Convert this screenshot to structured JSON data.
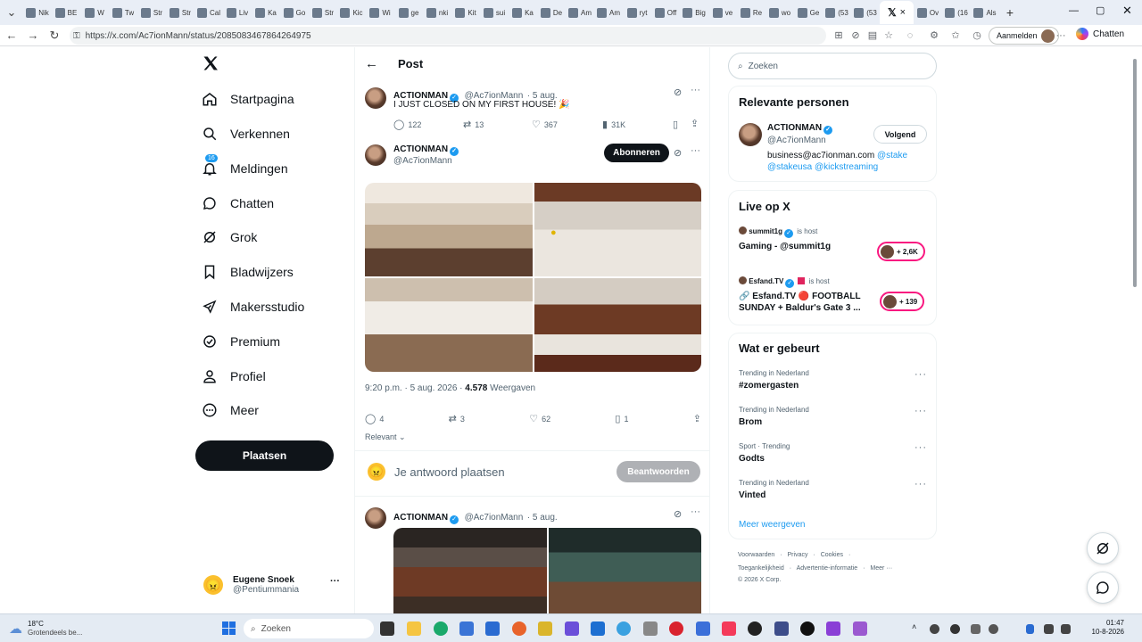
{
  "browser": {
    "tabs": [
      "Nik",
      "BE",
      "W",
      "Tw",
      "Str",
      "Str",
      "Cal",
      "Liv",
      "Ka",
      "Go",
      "Str",
      "Kic",
      "Wi",
      "ge",
      "nki",
      "Kit",
      "sui",
      "Ka",
      "De",
      "Am",
      "Am",
      "ryt",
      "Off",
      "Big",
      "ve",
      "Re",
      "wo",
      "Ge",
      "(53",
      "(53"
    ],
    "active_tab_close": "×",
    "extra_tabs": [
      "Ov",
      "(16",
      "Als"
    ],
    "new_tab": "+",
    "url": "https://x.com/Ac7ionMann/status/2085083467864264975",
    "signin_label": "Aanmelden",
    "copilot_label": "Chatten"
  },
  "nav": {
    "logo": "X",
    "items": [
      {
        "label": "Startpagina",
        "icon": "home-icon"
      },
      {
        "label": "Verkennen",
        "icon": "search-icon"
      },
      {
        "label": "Meldingen",
        "icon": "bell-icon",
        "badge": "16"
      },
      {
        "label": "Chatten",
        "icon": "chat-icon"
      },
      {
        "label": "Grok",
        "icon": "grok-icon"
      },
      {
        "label": "Bladwijzers",
        "icon": "bookmark-icon"
      },
      {
        "label": "Makersstudio",
        "icon": "rocket-icon"
      },
      {
        "label": "Premium",
        "icon": "premium-icon"
      },
      {
        "label": "Profiel",
        "icon": "profile-icon"
      },
      {
        "label": "Meer",
        "icon": "more-icon"
      }
    ],
    "post_button": "Plaatsen",
    "account": {
      "name": "Eugene Snoek",
      "handle": "@Pentiummania",
      "emoji": "😠",
      "more": "···"
    }
  },
  "header": {
    "back": "←",
    "title": "Post"
  },
  "quoted_post": {
    "name": "ACTIONMAN",
    "handle": "@Ac7ionMann",
    "date": "· 5 aug.",
    "text": "I JUST CLOSED ON MY FIRST HOUSE! 🎉",
    "replies": "122",
    "reposts": "13",
    "likes": "367",
    "views": "31K"
  },
  "main_post": {
    "name": "ACTIONMAN",
    "handle": "@Ac7ionMann",
    "follow_button": "Abonneren",
    "time": "9:20 p.m. · 5 aug. 2026 ·",
    "views_count": "4.578",
    "views_label": "Weergaven",
    "replies": "4",
    "reposts": "3",
    "likes": "62",
    "bookmarks": "1"
  },
  "sort_label": "Relevant",
  "reply_box": {
    "emoji": "😠",
    "placeholder": "Je antwoord plaatsen",
    "button": "Beantwoorden"
  },
  "next_post": {
    "name": "ACTIONMAN",
    "handle": "@Ac7ionMann",
    "date": "· 5 aug."
  },
  "right": {
    "search_placeholder": "Zoeken",
    "relevant": {
      "title": "Relevante personen",
      "name": "ACTIONMAN",
      "handle": "@Ac7ionMann",
      "button": "Volgend",
      "bio_prefix": "business@ac7ionman.com",
      "bio_link1": "@stake",
      "bio_links2": "@stakeusa @kickstreaming"
    },
    "live": {
      "title": "Live op X",
      "items": [
        {
          "host": "summit1g",
          "host_label": "is host",
          "title1": "Gaming - @summit1g",
          "title2": "",
          "count": "+ 2,6K"
        },
        {
          "host": "Esfand.TV",
          "host_label": "is host",
          "title1": "🔗 Esfand.TV 🔴 FOOTBALL",
          "title2": "SUNDAY + Baldur's Gate 3 ...",
          "count": "+ 139"
        }
      ]
    },
    "trends": {
      "title": "Wat er gebeurt",
      "items": [
        {
          "meta": "Trending in Nederland",
          "name": "#zomergasten"
        },
        {
          "meta": "Trending in Nederland",
          "name": "Brom"
        },
        {
          "meta": "Sport · Trending",
          "name": "Godts"
        },
        {
          "meta": "Trending in Nederland",
          "name": "Vinted"
        }
      ],
      "more": "Meer weergeven"
    },
    "footer": {
      "line1": [
        "Voorwaarden",
        "·",
        "Privacy",
        "·",
        "Cookies",
        "·"
      ],
      "line2": [
        "Toegankelijkheid",
        "·",
        "Advertentie-informatie",
        "·",
        "Meer ···"
      ],
      "copyright": "© 2026 X Corp."
    }
  },
  "taskbar": {
    "weather_temp": "18°C",
    "weather_desc": "Grotendeels be...",
    "search_placeholder": "Zoeken",
    "time": "01:47",
    "date": "10-8-2026"
  }
}
